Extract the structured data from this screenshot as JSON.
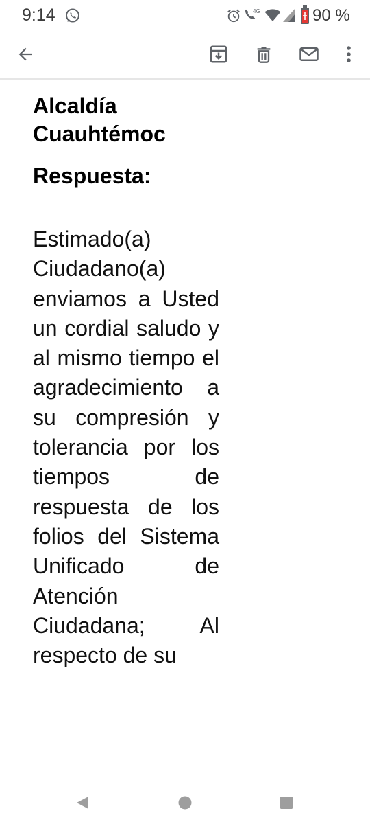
{
  "status_bar": {
    "time": "9:14",
    "battery": "90 %"
  },
  "toolbar": {
    "icons": [
      "back-arrow-icon",
      "archive-icon",
      "delete-icon",
      "mail-icon",
      "more-vert-icon"
    ]
  },
  "email": {
    "sender": "Alcaldía Cuauhtémoc",
    "label": "Respuesta:",
    "body": "Estimado(a) Ciudadano(a) enviamos a Usted un cordial saludo y al mismo tiempo el agradecimiento a su compresión y tolerancia por los tiempos de respuesta de los folios del Sistema Unificado de Atención Ciudadana; Al respecto de su"
  },
  "nav_bar": {
    "icons": [
      "back-triangle-icon",
      "home-circle-icon",
      "recents-square-icon"
    ]
  },
  "colors": {
    "icon": "#5f6368",
    "text": "#000000",
    "status_text": "#3c3c3c",
    "battery_accent": "#e53935",
    "nav_icon": "#9e9e9e"
  }
}
